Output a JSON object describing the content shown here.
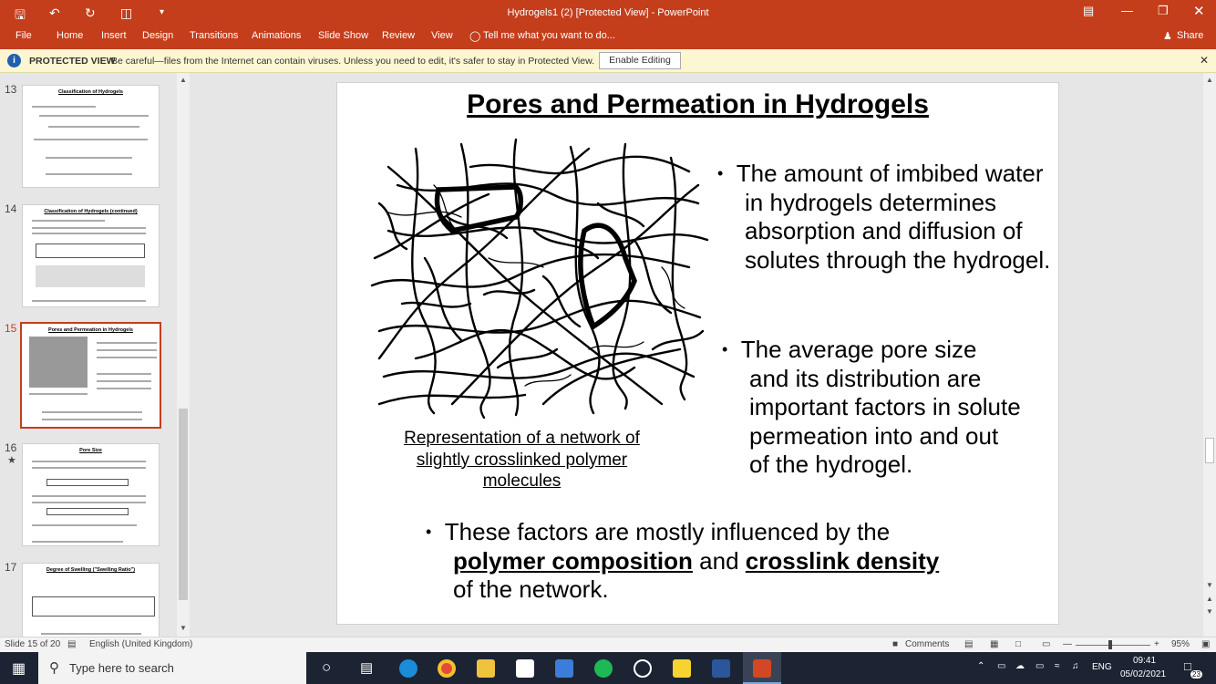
{
  "window": {
    "title": "Hydrogels1 (2) [Protected View] - PowerPoint"
  },
  "ribbon": {
    "tabs": [
      "File",
      "Home",
      "Insert",
      "Design",
      "Transitions",
      "Animations",
      "Slide Show",
      "Review",
      "View"
    ],
    "tell_me": "Tell me what you want to do...",
    "share": "Share"
  },
  "protected": {
    "label": "PROTECTED VIEW",
    "message": "Be careful—files from the Internet can contain viruses. Unless you need to edit, it's safer to stay in Protected View.",
    "button": "Enable Editing"
  },
  "thumbnails": [
    {
      "num": "13",
      "title": "Classification of Hydrogels"
    },
    {
      "num": "14",
      "title": "Classification of Hydrogels  (continued)"
    },
    {
      "num": "15",
      "title": "Pores and Permeation in Hydrogels"
    },
    {
      "num": "16",
      "title": "Pore Size"
    },
    {
      "num": "17",
      "title": "Degree of Swelling (\"Swelling Ratio\")"
    }
  ],
  "slide": {
    "title": "Pores and Permeation in Hydrogels",
    "bullet1": [
      "The amount of imbibed water",
      "in hydrogels determines",
      "absorption and diffusion of",
      "solutes through the hydrogel."
    ],
    "bullet2": [
      "The average pore size",
      "and its distribution are",
      "important factors in solute",
      "permeation into and out",
      "of the hydrogel."
    ],
    "bullet3_line1": "These factors are mostly influenced by the",
    "bullet3_bold1": "polymer composition",
    "bullet3_and": "and",
    "bullet3_bold2": "crosslink density",
    "bullet3_line3": "of the network.",
    "caption": [
      "Representation of a network of",
      "slightly crosslinked polymer",
      "molecules"
    ]
  },
  "status": {
    "slide_of": "Slide 15 of 20",
    "language": "English (United Kingdom)",
    "comments": "Comments",
    "zoom": "95%"
  },
  "taskbar": {
    "search_placeholder": "Type here to search",
    "lang": "ENG",
    "time": "09:41",
    "date": "05/02/2021",
    "notif": "23"
  }
}
